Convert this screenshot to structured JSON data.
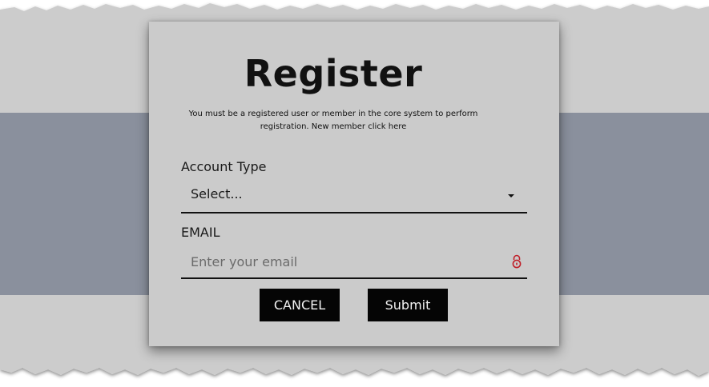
{
  "form": {
    "title": "Register",
    "subtitle_line1": "You must be a registered user or member in the core system to perform",
    "subtitle_line2": "registration. New member click here",
    "account_type": {
      "label": "Account Type",
      "selected": "Select...",
      "icon": "chevron-down-icon"
    },
    "email": {
      "label": "EMAIL",
      "value": "",
      "placeholder": "Enter your email",
      "icon": "lock-icon",
      "icon_color": "#c0202a"
    },
    "buttons": {
      "cancel_label": "CANCEL",
      "submit_label": "Submit"
    }
  },
  "colors": {
    "card_bg": "#cbcbcb",
    "band": "#8a909d",
    "page_bg": "#cccccc",
    "button_bg": "#050505"
  }
}
